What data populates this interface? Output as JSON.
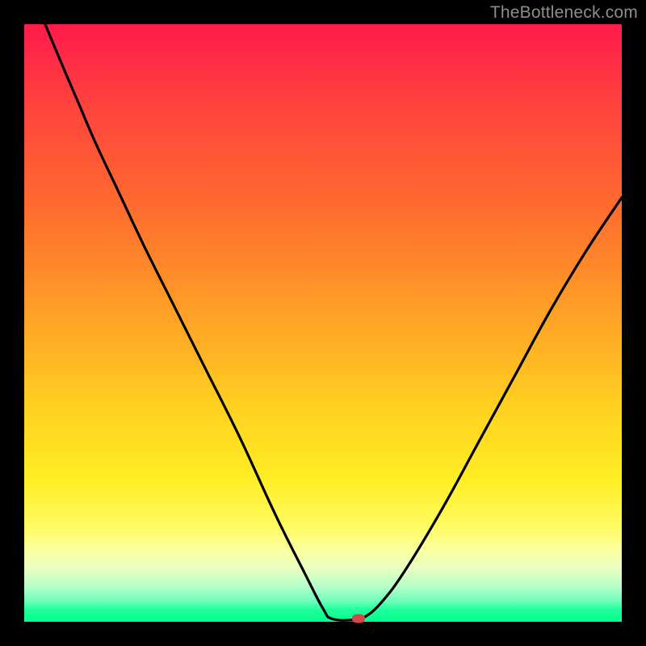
{
  "watermark": {
    "text": "TheBottleneck.com"
  },
  "chart_data": {
    "type": "line",
    "title": "",
    "xlabel": "",
    "ylabel": "",
    "xlim": [
      0,
      100
    ],
    "ylim": [
      0,
      100
    ],
    "grid": false,
    "legend": false,
    "curve": [
      {
        "x": 3.5,
        "y": 100
      },
      {
        "x": 6,
        "y": 94
      },
      {
        "x": 9,
        "y": 87
      },
      {
        "x": 12,
        "y": 80
      },
      {
        "x": 16,
        "y": 71.5
      },
      {
        "x": 20,
        "y": 63
      },
      {
        "x": 25,
        "y": 53
      },
      {
        "x": 30,
        "y": 43
      },
      {
        "x": 36,
        "y": 31
      },
      {
        "x": 42,
        "y": 18
      },
      {
        "x": 47,
        "y": 8
      },
      {
        "x": 50,
        "y": 2.2
      },
      {
        "x": 51.5,
        "y": 0.5
      },
      {
        "x": 55,
        "y": 0.3
      },
      {
        "x": 57,
        "y": 0.8
      },
      {
        "x": 60,
        "y": 3.5
      },
      {
        "x": 64,
        "y": 9
      },
      {
        "x": 70,
        "y": 19
      },
      {
        "x": 76,
        "y": 30
      },
      {
        "x": 82,
        "y": 41
      },
      {
        "x": 88,
        "y": 52
      },
      {
        "x": 94,
        "y": 62
      },
      {
        "x": 100,
        "y": 71
      }
    ],
    "marker": {
      "x": 56,
      "y": 0.5,
      "color": "#d24a45"
    },
    "background_gradient": [
      {
        "stop": 0.0,
        "color": "#ff1a4b"
      },
      {
        "stop": 0.5,
        "color": "#ffa526"
      },
      {
        "stop": 0.8,
        "color": "#fff54a"
      },
      {
        "stop": 1.0,
        "color": "#00ff87"
      }
    ]
  }
}
